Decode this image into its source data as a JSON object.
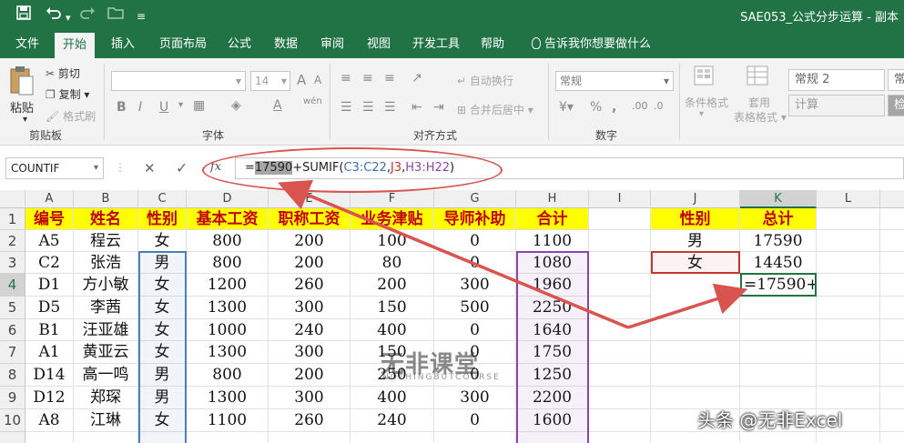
{
  "titlebar": {
    "save_icon": "save-icon",
    "undo_icon": "undo-icon",
    "redo_icon": "redo-icon",
    "open_icon": "folder-icon",
    "title": "SAE053_公式分步运算 - 副本"
  },
  "tabs": [
    "文件",
    "开始",
    "插入",
    "页面布局",
    "公式",
    "数据",
    "审阅",
    "视图",
    "开发工具",
    "帮助",
    "告诉我你想要做什么"
  ],
  "active_tab": "开始",
  "ribbon": {
    "clipboard": {
      "paste": "粘贴",
      "cut": "剪切",
      "copy": "复制",
      "format_painter": "格式刷",
      "label": "剪贴板"
    },
    "font": {
      "label": "字体",
      "size": "14",
      "bold": "B",
      "italic": "I",
      "underline": "U",
      "wen": "wén",
      "grow": "A",
      "shrink": "A"
    },
    "alignment": {
      "wrap": "自动换行",
      "merge": "合并后居中",
      "label": "对齐方式"
    },
    "number": {
      "format": "常规",
      "label": "数字",
      "percent": "%",
      "comma": ","
    },
    "styles": {
      "cond_format": "条件格式",
      "table_format_1": "套用",
      "table_format_2": "表格格式",
      "style1": "常规 2",
      "style2": "计算",
      "style3": "常",
      "style4": "检"
    }
  },
  "formula_bar": {
    "name_box": "COUNTIF",
    "cancel": "✕",
    "enter": "✓",
    "fx": "fx",
    "formula_prefix": "=",
    "formula_highlight": "17590",
    "formula_mid": "+SUMIF(",
    "ref1": "C3:C22",
    "comma1": ",",
    "ref2": "J3",
    "comma2": ",",
    "ref3": "H3:H22",
    "formula_end": ")"
  },
  "columns": [
    "A",
    "B",
    "C",
    "D",
    "E",
    "F",
    "G",
    "H",
    "I",
    "J",
    "K",
    "L"
  ],
  "rows": [
    "1",
    "2",
    "3",
    "4",
    "5",
    "6",
    "7",
    "8",
    "9",
    "10"
  ],
  "table": {
    "headers": [
      "编号",
      "姓名",
      "性别",
      "基本工资",
      "职称工资",
      "业务津贴",
      "导师补助",
      "合计"
    ],
    "data": [
      [
        "A5",
        "程云",
        "女",
        "800",
        "200",
        "100",
        "0",
        "1100"
      ],
      [
        "C2",
        "张浩",
        "男",
        "800",
        "200",
        "80",
        "0",
        "1080"
      ],
      [
        "D1",
        "方小敏",
        "女",
        "1200",
        "260",
        "200",
        "300",
        "1960"
      ],
      [
        "D5",
        "李茜",
        "女",
        "1300",
        "300",
        "150",
        "500",
        "2250"
      ],
      [
        "B1",
        "汪亚雄",
        "女",
        "1000",
        "240",
        "400",
        "0",
        "1640"
      ],
      [
        "A1",
        "黄亚云",
        "女",
        "1300",
        "300",
        "150",
        "0",
        "1750"
      ],
      [
        "D14",
        "高一鸣",
        "男",
        "800",
        "200",
        "250",
        "0",
        "1250"
      ],
      [
        "D12",
        "郑琛",
        "男",
        "1300",
        "300",
        "400",
        "300",
        "2200"
      ],
      [
        "A8",
        "江琳",
        "女",
        "1100",
        "260",
        "240",
        "0",
        "1600"
      ]
    ]
  },
  "summary": {
    "headers": [
      "性别",
      "总计"
    ],
    "rows": [
      [
        "男",
        "17590"
      ],
      [
        "女",
        "14450"
      ]
    ],
    "active_cell_value": "=17590+"
  },
  "watermark": {
    "main": "无非课堂",
    "sub": "NOTHINGBUTCOURSE"
  },
  "source_credit": "头条 @无非Excel",
  "colors": {
    "excel_green": "#217346",
    "header_yellow": "#ffff00",
    "header_red": "#c00000",
    "annotation_red": "#d9534f"
  }
}
